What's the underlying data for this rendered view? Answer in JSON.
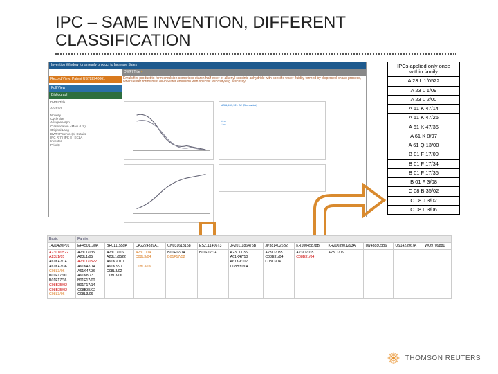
{
  "title": "IPC – SAME INVENTION, DIFFERENT CLASSIFICATION",
  "screenshot": {
    "top_bar": "Invention Window for an early product to Increase Sales",
    "dwpi_title_label": "DWPI Title",
    "record_bar": "Record View: Patent US782940061",
    "emulsion_text": "Emulsifier product to form emulsion comprises starch half ester of alkenyl succinic anhydride with specific water fluidity formed by dispersed phase process, where ester forms best oil-in-water emulsion with specific viscosity e.g. viscosity",
    "full_view": "Full View",
    "biblio": "Bibliograph",
    "left_items": [
      "DWPI Title",
      "Abstract",
      "Novelty",
      "Cycle title",
      "Assignee/App",
      "Classification - Main (US)",
      "Original Lang",
      "DWPI Patentee(s) Details",
      "IPC R 7 / IPC 8 / ECLA",
      "Inventor",
      "Priority"
    ],
    "links": [
      "US 6,451,121 B2 (Brunswick)",
      "Link",
      "Link",
      "Link"
    ]
  },
  "side_table": {
    "header": "IPCs applied only once within family",
    "rows": [
      "A 23 L 1/0522",
      "A 23 L 1/09",
      "A 23 L 2/00",
      "A 61 K 47/14",
      "A 61 K 47/26",
      "A 61 K 47/36",
      "A 61 K 8/97",
      "A 61 Q 13/00",
      "B 01 F 17/00",
      "B 01 F 17/34",
      "B 01 F 17/36",
      "B 01 F 3/08",
      "C 08 B 35/02",
      "C 08 J 3/02",
      "C 08 L 3/06"
    ]
  },
  "bottom_table": {
    "headers": [
      "Basic",
      "Family:",
      "",
      "",
      "",
      "",
      "",
      "",
      "",
      "",
      "",
      ""
    ],
    "row1": [
      "1420420P01",
      "EP4501130A",
      "BR0111559A",
      "CA2224839A1",
      "CN031613158",
      "ES2111406T3",
      "JP2011186475B",
      "JP3814026B2",
      "KR10045878B",
      "KR2003901293A",
      "TW488805B6",
      "US1423967A",
      "WO9709881"
    ],
    "cells": [
      {
        "c0": [
          "A23L1/0522",
          "A23L1/05",
          "A61K47/14",
          "A61K47/36",
          "C08L3/06",
          "B01F17/00",
          "B01F17/36",
          "C08B35/02",
          "C08B35/02",
          "C08L3/06"
        ],
        "c1": [
          "A23L1/035",
          "A23L1/05",
          "A23L1/0522",
          "A61K47/14",
          "A61K47/36",
          "A61K8/73",
          "B01F17/00",
          "B01F17/14",
          "C08B35/02",
          "C08L3/06"
        ],
        "c2": [
          "A23L1/016",
          "A23L1/0522",
          "A61K9/107",
          "A61K8/97",
          "C08L3/02",
          "C08L3/06"
        ],
        "c3": [
          "A23L1/04",
          "C08L3/04",
          "",
          "C08L3/06"
        ],
        "c4": [
          "B01F17/14",
          "B01F17/52"
        ],
        "c5": [
          "B01F17/14"
        ],
        "c6": [
          "A23L1/035",
          "A61K47/10",
          "A61K9/107",
          "C08B31/04"
        ],
        "c7": [
          "A23L1/035",
          "C08B31/04",
          "C08L3/04"
        ],
        "c8": [
          "A23L1/035",
          "C08B31/04"
        ],
        "c9": [
          "A23L1/05"
        ],
        "c10": [],
        "c11": [],
        "c12": []
      }
    ],
    "highlighted": {
      "c0_red": [
        "A23L1/0522",
        "A23L1/05",
        "C08B35/02",
        "C08B35/02"
      ],
      "c0_orange": [
        "C08L3/06"
      ],
      "c1_red": [
        "A23L1/0522"
      ],
      "c3_orange": [
        "C08L3/04",
        "C08L3/06"
      ],
      "c4_orange": [
        "B01F17/52"
      ],
      "c8_red": [
        "C08B31/04"
      ]
    }
  },
  "footer": "THOMSON REUTERS"
}
